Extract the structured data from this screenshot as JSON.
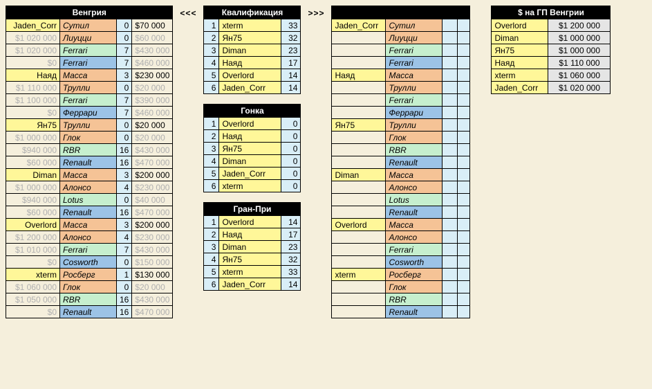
{
  "left": {
    "title": "Венгрия",
    "groups": [
      {
        "player": "Jaden_Corr",
        "rows": [
          {
            "c1": "Jaden_Corr",
            "c2": "Сутил",
            "c3": "0",
            "c4": "$70 000",
            "r1": "c-yellow",
            "r2": "c-orange"
          },
          {
            "c1": "$1 020 000",
            "c2": "Лиуцци",
            "c3": "0",
            "c4": "$60 000",
            "r1": "",
            "r2": "c-orange",
            "g1": true,
            "g4": true
          },
          {
            "c1": "$1 020 000",
            "c2": "Ferrari",
            "c3": "7",
            "c4": "$430 000",
            "r1": "",
            "r2": "c-green",
            "g1": true,
            "g4": true
          },
          {
            "c1": "$0",
            "c2": "Ferrari",
            "c3": "7",
            "c4": "$460 000",
            "r1": "",
            "r2": "c-blue",
            "g1": true,
            "g4": true
          }
        ]
      },
      {
        "player": "Наяд",
        "rows": [
          {
            "c1": "Наяд",
            "c2": "Масса",
            "c3": "3",
            "c4": "$230 000",
            "r1": "c-yellow",
            "r2": "c-orange"
          },
          {
            "c1": "$1 110 000",
            "c2": "Трулли",
            "c3": "0",
            "c4": "$20 000",
            "r1": "",
            "r2": "c-orange",
            "g1": true,
            "g4": true
          },
          {
            "c1": "$1 100 000",
            "c2": "Ferrari",
            "c3": "7",
            "c4": "$390 000",
            "r1": "",
            "r2": "c-green",
            "g1": true,
            "g4": true
          },
          {
            "c1": "$0",
            "c2": "Феррари",
            "c3": "7",
            "c4": "$460 000",
            "r1": "",
            "r2": "c-blue",
            "g1": true,
            "g4": true
          }
        ]
      },
      {
        "player": "Ян75",
        "rows": [
          {
            "c1": "Ян75",
            "c2": "Трулли",
            "c3": "0",
            "c4": "$20 000",
            "r1": "c-yellow",
            "r2": "c-orange"
          },
          {
            "c1": "$1 000 000",
            "c2": "Глок",
            "c3": "0",
            "c4": "$20 000",
            "r1": "",
            "r2": "c-orange",
            "g1": true,
            "g4": true
          },
          {
            "c1": "$940 000",
            "c2": "RBR",
            "c3": "16",
            "c4": "$430 000",
            "r1": "",
            "r2": "c-green",
            "g1": true,
            "g4": true
          },
          {
            "c1": "$60 000",
            "c2": "Renault",
            "c3": "16",
            "c4": "$470 000",
            "r1": "",
            "r2": "c-blue",
            "g1": true,
            "g4": true
          }
        ]
      },
      {
        "player": "Diman",
        "rows": [
          {
            "c1": "Diman",
            "c2": "Масса",
            "c3": "3",
            "c4": "$200 000",
            "r1": "c-yellow",
            "r2": "c-orange"
          },
          {
            "c1": "$1 000 000",
            "c2": "Алонсо",
            "c3": "4",
            "c4": "$230 000",
            "r1": "",
            "r2": "c-orange",
            "g1": true,
            "g4": true
          },
          {
            "c1": "$940 000",
            "c2": "Lotus",
            "c3": "0",
            "c4": "$40 000",
            "r1": "",
            "r2": "c-green",
            "g1": true,
            "g4": true
          },
          {
            "c1": "$60 000",
            "c2": "Renault",
            "c3": "16",
            "c4": "$470 000",
            "r1": "",
            "r2": "c-blue",
            "g1": true,
            "g4": true
          }
        ]
      },
      {
        "player": "Overlord",
        "rows": [
          {
            "c1": "Overlord",
            "c2": "Масса",
            "c3": "3",
            "c4": "$200 000",
            "r1": "c-yellow",
            "r2": "c-orange"
          },
          {
            "c1": "$1 200 000",
            "c2": "Алонсо",
            "c3": "4",
            "c4": "$230 000",
            "r1": "",
            "r2": "c-orange",
            "g1": true,
            "g4": true
          },
          {
            "c1": "$1 010 000",
            "c2": "Ferrari",
            "c3": "7",
            "c4": "$430 000",
            "r1": "",
            "r2": "c-green",
            "g1": true,
            "g4": true
          },
          {
            "c1": "$0",
            "c2": "Cosworth",
            "c3": "0",
            "c4": "$150 000",
            "r1": "",
            "r2": "c-blue",
            "g1": true,
            "g4": true
          }
        ]
      },
      {
        "player": "xterm",
        "rows": [
          {
            "c1": "xterm",
            "c2": "Росберг",
            "c3": "1",
            "c4": "$130 000",
            "r1": "c-yellow",
            "r2": "c-orange"
          },
          {
            "c1": "$1 060 000",
            "c2": "Глок",
            "c3": "0",
            "c4": "$20 000",
            "r1": "",
            "r2": "c-orange",
            "g1": true,
            "g4": true
          },
          {
            "c1": "$1 050 000",
            "c2": "RBR",
            "c3": "16",
            "c4": "$430 000",
            "r1": "",
            "r2": "c-green",
            "g1": true,
            "g4": true
          },
          {
            "c1": "$0",
            "c2": "Renault",
            "c3": "16",
            "c4": "$470 000",
            "r1": "",
            "r2": "c-blue",
            "g1": true,
            "g4": true
          }
        ]
      }
    ]
  },
  "left_arrow": "<<<",
  "right_arrow": ">>>",
  "mid": [
    {
      "title": "Квалификация",
      "rows": [
        {
          "n": "1",
          "name": "xterm",
          "v": "33"
        },
        {
          "n": "2",
          "name": "Ян75",
          "v": "32"
        },
        {
          "n": "3",
          "name": "Diman",
          "v": "23"
        },
        {
          "n": "4",
          "name": "Наяд",
          "v": "17"
        },
        {
          "n": "5",
          "name": "Overlord",
          "v": "14"
        },
        {
          "n": "6",
          "name": "Jaden_Corr",
          "v": "14"
        }
      ]
    },
    {
      "title": "Гонка",
      "rows": [
        {
          "n": "1",
          "name": "Overlord",
          "v": "0"
        },
        {
          "n": "2",
          "name": "Наяд",
          "v": "0"
        },
        {
          "n": "3",
          "name": "Ян75",
          "v": "0"
        },
        {
          "n": "4",
          "name": "Diman",
          "v": "0"
        },
        {
          "n": "5",
          "name": "Jaden_Corr",
          "v": "0"
        },
        {
          "n": "6",
          "name": "xterm",
          "v": "0"
        }
      ]
    },
    {
      "title": "Гран-При",
      "rows": [
        {
          "n": "1",
          "name": "Overlord",
          "v": "14"
        },
        {
          "n": "2",
          "name": "Наяд",
          "v": "17"
        },
        {
          "n": "3",
          "name": "Diman",
          "v": "23"
        },
        {
          "n": "4",
          "name": "Ян75",
          "v": "32"
        },
        {
          "n": "5",
          "name": "xterm",
          "v": "33"
        },
        {
          "n": "6",
          "name": "Jaden_Corr",
          "v": "14"
        }
      ]
    }
  ],
  "right": {
    "title": "",
    "groups": [
      {
        "rows": [
          {
            "c1": "Jaden_Corr",
            "c2": "Сутил",
            "r1": "c-yellow",
            "r2": "c-orange"
          },
          {
            "c1": "",
            "c2": "Лиуцци",
            "r1": "",
            "r2": "c-orange"
          },
          {
            "c1": "",
            "c2": "Ferrari",
            "r1": "",
            "r2": "c-green"
          },
          {
            "c1": "",
            "c2": "Ferrari",
            "r1": "",
            "r2": "c-blue"
          }
        ]
      },
      {
        "rows": [
          {
            "c1": "Наяд",
            "c2": "Масса",
            "r1": "c-yellow",
            "r2": "c-orange"
          },
          {
            "c1": "",
            "c2": "Трулли",
            "r1": "",
            "r2": "c-orange"
          },
          {
            "c1": "",
            "c2": "Ferrari",
            "r1": "",
            "r2": "c-green"
          },
          {
            "c1": "",
            "c2": "Феррари",
            "r1": "",
            "r2": "c-blue"
          }
        ]
      },
      {
        "rows": [
          {
            "c1": "Ян75",
            "c2": "Трулли",
            "r1": "c-yellow",
            "r2": "c-orange"
          },
          {
            "c1": "",
            "c2": "Глок",
            "r1": "",
            "r2": "c-orange"
          },
          {
            "c1": "",
            "c2": "RBR",
            "r1": "",
            "r2": "c-green"
          },
          {
            "c1": "",
            "c2": "Renault",
            "r1": "",
            "r2": "c-blue"
          }
        ]
      },
      {
        "rows": [
          {
            "c1": "Diman",
            "c2": "Масса",
            "r1": "c-yellow",
            "r2": "c-orange"
          },
          {
            "c1": "",
            "c2": "Алонсо",
            "r1": "",
            "r2": "c-orange"
          },
          {
            "c1": "",
            "c2": "Lotus",
            "r1": "",
            "r2": "c-green"
          },
          {
            "c1": "",
            "c2": "Renault",
            "r1": "",
            "r2": "c-blue"
          }
        ]
      },
      {
        "rows": [
          {
            "c1": "Overlord",
            "c2": "Масса",
            "r1": "c-yellow",
            "r2": "c-orange"
          },
          {
            "c1": "",
            "c2": "Алонсо",
            "r1": "",
            "r2": "c-orange"
          },
          {
            "c1": "",
            "c2": "Ferrari",
            "r1": "",
            "r2": "c-green"
          },
          {
            "c1": "",
            "c2": "Cosworth",
            "r1": "",
            "r2": "c-blue"
          }
        ]
      },
      {
        "rows": [
          {
            "c1": "xterm",
            "c2": "Росберг",
            "r1": "c-yellow",
            "r2": "c-orange"
          },
          {
            "c1": "",
            "c2": "Глок",
            "r1": "",
            "r2": "c-orange"
          },
          {
            "c1": "",
            "c2": "RBR",
            "r1": "",
            "r2": "c-green"
          },
          {
            "c1": "",
            "c2": "Renault",
            "r1": "",
            "r2": "c-blue"
          }
        ]
      }
    ]
  },
  "money": {
    "title": "$ на ГП Венгрии",
    "rows": [
      {
        "name": "Overlord",
        "val": "$1 200 000"
      },
      {
        "name": "Diman",
        "val": "$1 000 000"
      },
      {
        "name": "Ян75",
        "val": "$1 000 000"
      },
      {
        "name": "Наяд",
        "val": "$1 110 000"
      },
      {
        "name": "xterm",
        "val": "$1 060 000"
      },
      {
        "name": "Jaden_Corr",
        "val": "$1 020 000"
      }
    ]
  }
}
